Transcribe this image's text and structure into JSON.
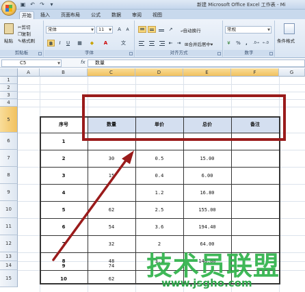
{
  "window": {
    "title": "新建 Microsoft Office Excel 工作表 - Mi"
  },
  "tabs": [
    {
      "label": "开始",
      "active": true
    },
    {
      "label": "插入"
    },
    {
      "label": "页面布局"
    },
    {
      "label": "公式"
    },
    {
      "label": "数据"
    },
    {
      "label": "审阅"
    },
    {
      "label": "视图"
    }
  ],
  "ribbon": {
    "clipboard": {
      "paste": "粘贴",
      "cut": "剪切",
      "copy": "复制",
      "format_painter": "格式刷",
      "label": "剪贴板"
    },
    "font": {
      "name": "宋体",
      "size": "11",
      "bold": "B",
      "italic": "I",
      "underline": "U",
      "label": "字体",
      "grow": "A",
      "shrink": "A",
      "font_color_glyph": "A",
      "wen": "文"
    },
    "alignment": {
      "wrap": "自动换行",
      "merge": "合并后居中",
      "label": "对齐方式"
    },
    "number": {
      "format": "常规",
      "percent": "%",
      "comma": ",",
      "label": "数字"
    },
    "styles": {
      "conditional": "条件格式"
    }
  },
  "formula_bar": {
    "name_box": "C5",
    "fx": "fx",
    "value": "数量"
  },
  "columns": [
    "A",
    "B",
    "C",
    "D",
    "E",
    "F",
    "G"
  ],
  "rows": [
    "1",
    "2",
    "3",
    "4",
    "5",
    "6",
    "7",
    "8",
    "9",
    "10",
    "11",
    "12",
    "13",
    "14",
    "15"
  ],
  "table": {
    "headers": [
      "序号",
      "数量",
      "单价",
      "总价",
      "备注"
    ],
    "rows": [
      [
        "1",
        "",
        "",
        "",
        ""
      ],
      [
        "2",
        "30",
        "0.5",
        "15.00",
        ""
      ],
      [
        "3",
        "15",
        "0.4",
        "6.00",
        ""
      ],
      [
        "4",
        "",
        "1.2",
        "16.80",
        ""
      ],
      [
        "5",
        "62",
        "2.5",
        "155.00",
        ""
      ],
      [
        "6",
        "54",
        "3.6",
        "194.40",
        ""
      ],
      [
        "7",
        "32",
        "2",
        "64.00",
        ""
      ],
      [
        "8",
        "48",
        "3.1",
        "148.80",
        ""
      ],
      [
        "9",
        "74",
        "",
        "",
        ""
      ],
      [
        "10",
        "62",
        "",
        "",
        ""
      ]
    ]
  },
  "watermark": {
    "text": "技术员联盟",
    "url": "www.jsgho.com"
  },
  "colors": {
    "annotation": "#9a1b1b",
    "watermark": "#2fb24a"
  }
}
